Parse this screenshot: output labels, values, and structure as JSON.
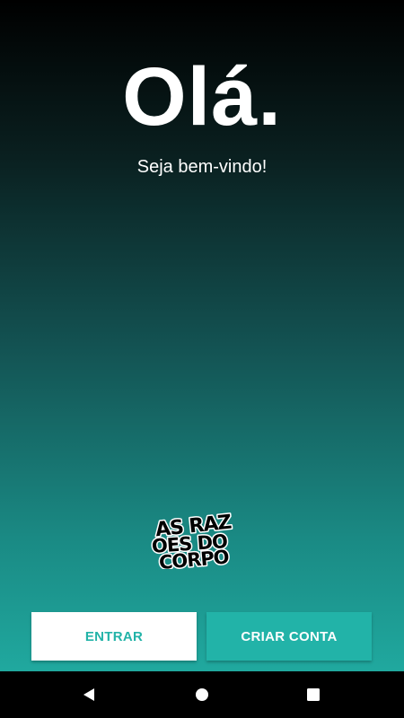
{
  "welcome": {
    "title": "Olá.",
    "subtitle": "Seja bem-vindo!"
  },
  "logo": {
    "text_lines": [
      "AS RAZ",
      "OES DO",
      "CORPO"
    ],
    "name": "As Razões do Corpo"
  },
  "actions": {
    "login_label": "ENTRAR",
    "signup_label": "CRIAR CONTA"
  },
  "colors": {
    "accent": "#22b3a8",
    "background_top": "#000000",
    "background_bottom": "#22b3a8",
    "white": "#ffffff"
  },
  "navbar": {
    "icons": [
      "back-icon",
      "home-icon",
      "recents-icon"
    ]
  }
}
